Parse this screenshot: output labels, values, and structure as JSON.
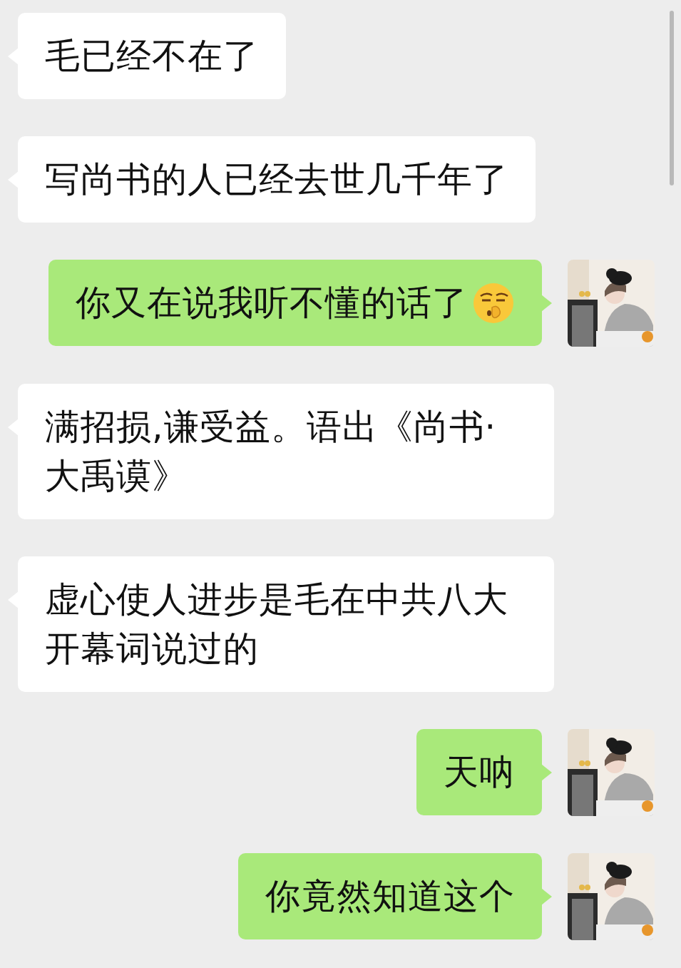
{
  "messages": [
    {
      "kind": "incoming",
      "text": "毛已经不在了"
    },
    {
      "kind": "incoming",
      "text": "写尚书的人已经去世几千年了"
    },
    {
      "kind": "outgoing",
      "text": "你又在说我听不懂的话了",
      "emoji": true
    },
    {
      "kind": "incoming",
      "text": "满招损,谦受益。语出《尚书·大禹谟》"
    },
    {
      "kind": "incoming",
      "text": "虚心使人进步是毛在中共八大开幕词说过的"
    },
    {
      "kind": "outgoing",
      "text": "天呐",
      "emoji": false
    },
    {
      "kind": "outgoing",
      "text": "你竟然知道这个",
      "emoji": false
    }
  ]
}
